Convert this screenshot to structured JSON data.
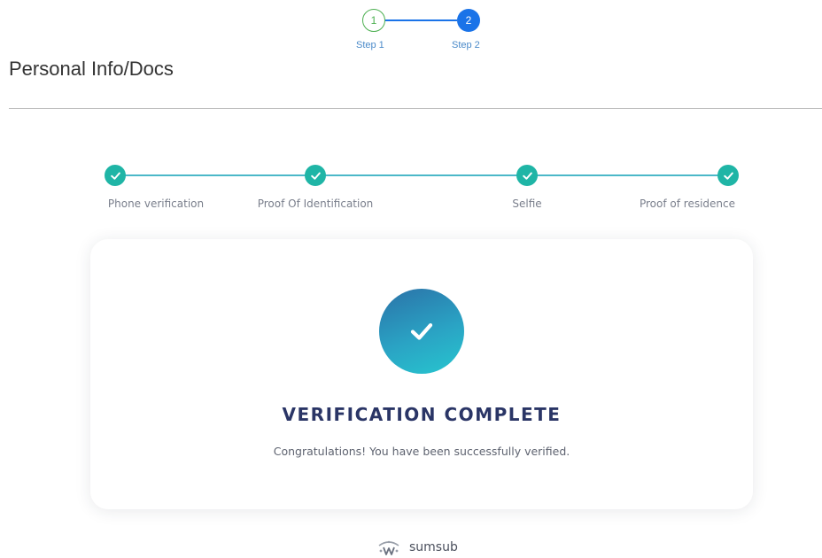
{
  "top_stepper": {
    "steps": [
      {
        "number": "1",
        "label": "Step 1"
      },
      {
        "number": "2",
        "label": "Step 2"
      }
    ]
  },
  "page_title": "Personal Info/Docs",
  "verification_steps": [
    {
      "label": "Phone verification"
    },
    {
      "label": "Proof Of Identification"
    },
    {
      "label": "Selfie"
    },
    {
      "label": "Proof of residence"
    }
  ],
  "card": {
    "heading": "VERIFICATION COMPLETE",
    "message": "Congratulations! You have been successfully verified."
  },
  "brand": {
    "name": "sumsub"
  },
  "icons": {
    "step_check": "check-icon",
    "card_check": "check-circle-icon",
    "brand_logo": "sumsub-logo-icon"
  },
  "colors": {
    "accent_blue": "#1a73e8",
    "success_green": "#4caf50",
    "teal": "#1fb5a6",
    "heading_navy": "#2a3566"
  }
}
